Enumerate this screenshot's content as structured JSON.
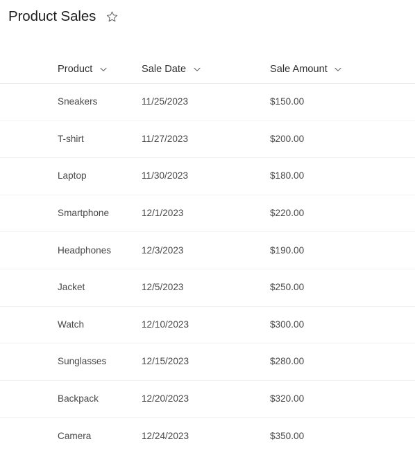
{
  "header": {
    "title": "Product Sales",
    "favorite_icon": "star-outline-icon",
    "favorite_state": "not-favorited"
  },
  "table": {
    "columns": [
      {
        "key": "product",
        "label": "Product",
        "sort_icon": "chevron-down-icon"
      },
      {
        "key": "sale_date",
        "label": "Sale Date",
        "sort_icon": "chevron-down-icon"
      },
      {
        "key": "sale_amount",
        "label": "Sale Amount",
        "sort_icon": "chevron-down-icon"
      }
    ],
    "rows": [
      {
        "product": "Sneakers",
        "sale_date": "11/25/2023",
        "sale_amount": "$150.00"
      },
      {
        "product": "T-shirt",
        "sale_date": "11/27/2023",
        "sale_amount": "$200.00"
      },
      {
        "product": "Laptop",
        "sale_date": "11/30/2023",
        "sale_amount": "$180.00"
      },
      {
        "product": "Smartphone",
        "sale_date": "12/1/2023",
        "sale_amount": "$220.00"
      },
      {
        "product": "Headphones",
        "sale_date": "12/3/2023",
        "sale_amount": "$190.00"
      },
      {
        "product": "Jacket",
        "sale_date": "12/5/2023",
        "sale_amount": "$250.00"
      },
      {
        "product": "Watch",
        "sale_date": "12/10/2023",
        "sale_amount": "$300.00"
      },
      {
        "product": "Sunglasses",
        "sale_date": "12/15/2023",
        "sale_amount": "$280.00"
      },
      {
        "product": "Backpack",
        "sale_date": "12/20/2023",
        "sale_amount": "$320.00"
      },
      {
        "product": "Camera",
        "sale_date": "12/24/2023",
        "sale_amount": "$350.00"
      }
    ]
  },
  "colors": {
    "title_text": "#201f1e",
    "header_text": "#323130",
    "cell_text": "#4a4846",
    "header_divider": "#edebe9",
    "row_divider": "#f3f2f1",
    "background": "#ffffff",
    "icon_stroke": "#605e5c"
  }
}
